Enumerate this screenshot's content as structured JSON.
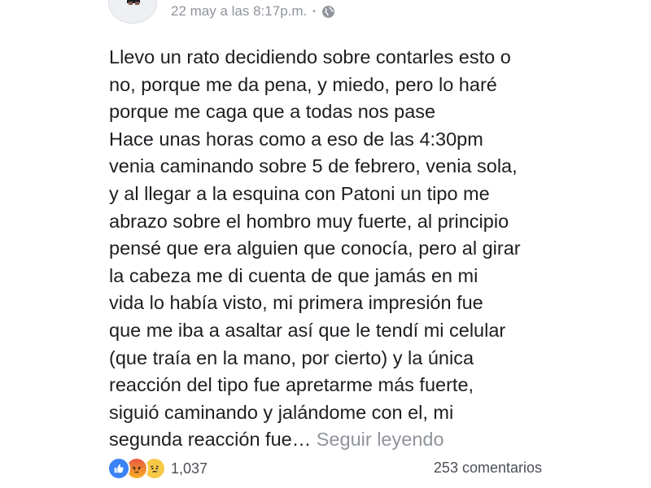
{
  "post": {
    "timestamp": "22 may a las 8:17p.m.",
    "separator": "•",
    "privacy_icon": "globe-icon",
    "lines": [
      "Llevo un rato decidiendo sobre contarles esto o",
      "no, porque me da pena, y miedo, pero lo haré",
      "porque me caga que a todas nos pase",
      "Hace unas horas como a eso de las 4:30pm",
      "venia caminando sobre 5 de febrero, venia sola,",
      "y al llegar a la esquina con Patoni un tipo me",
      "abrazo sobre el hombro muy fuerte, al principio",
      "pensé que era alguien que conocía, pero al girar",
      "la cabeza me di cuenta de que jamás en mi",
      "vida lo había visto, mi primera impresión fue",
      "que me iba a asaltar así que le tendí mi celular",
      "(que traía en la mano, por cierto) y la única",
      "reacción del tipo fue apretarme más fuerte,",
      "siguió caminando y jalándome con el, mi"
    ],
    "last_line": "segunda reacción fue…",
    "see_more": "Seguir leyendo"
  },
  "footer": {
    "reaction_icons": [
      "like-icon",
      "angry-icon",
      "sad-icon"
    ],
    "reaction_count": "1,037",
    "comments": "253 comentarios"
  },
  "colors": {
    "text": "#1c1e21",
    "muted": "#90949c",
    "like": "#3b82f6"
  }
}
